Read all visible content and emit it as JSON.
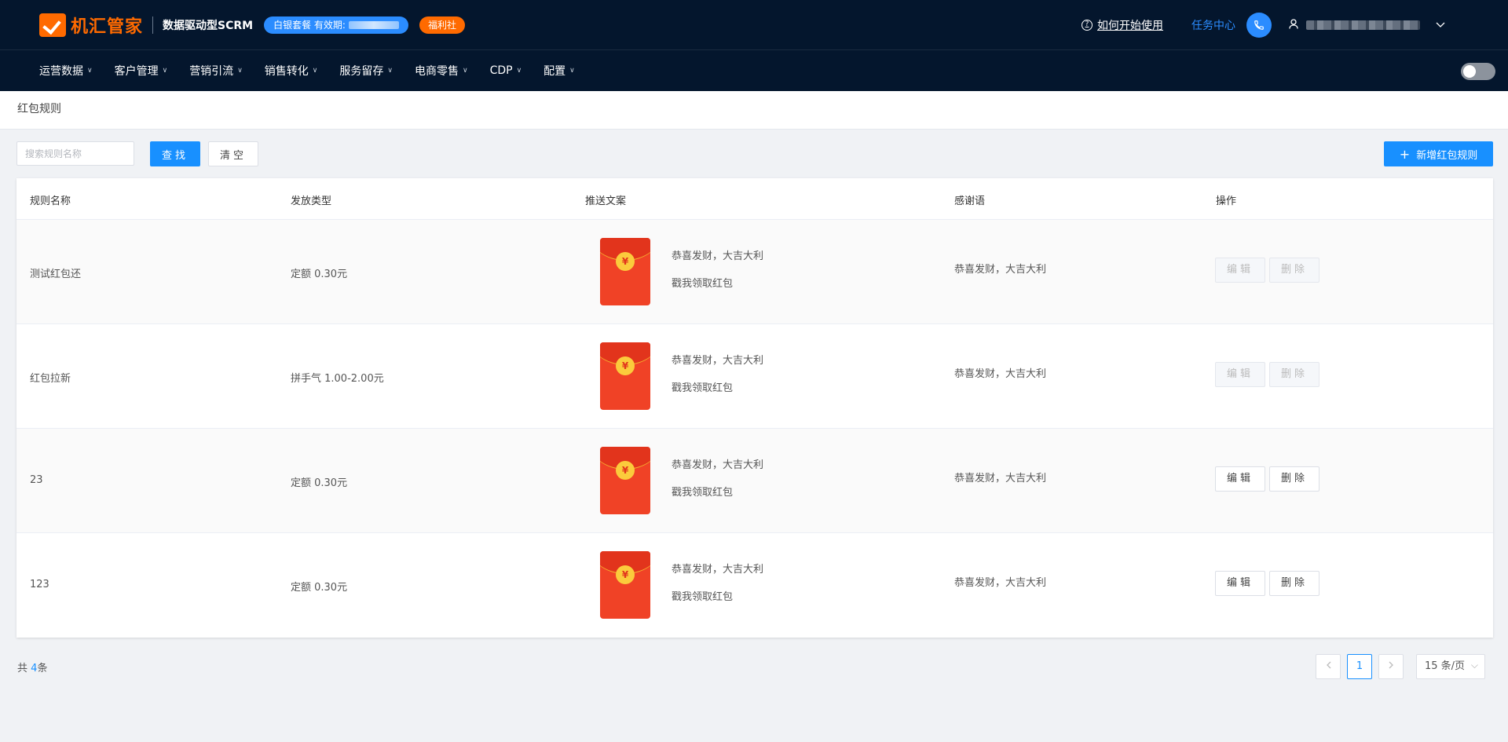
{
  "header": {
    "logo_text": "机汇管家",
    "logo_sub": "数据驱动型SCRM",
    "package_label": "白银套餐  有效期:",
    "welfare_label": "福利社",
    "help_label": "如何开始使用",
    "task_label": "任务中心"
  },
  "nav": {
    "items": [
      {
        "label": "运营数据"
      },
      {
        "label": "客户管理"
      },
      {
        "label": "营销引流"
      },
      {
        "label": "销售转化"
      },
      {
        "label": "服务留存"
      },
      {
        "label": "电商零售"
      },
      {
        "label": "CDP"
      },
      {
        "label": "配置"
      }
    ]
  },
  "breadcrumb": "红包规则",
  "toolbar": {
    "search_placeholder": "搜索规则名称",
    "search_label": "查找",
    "clear_label": "清空",
    "add_label": "新增红包规则"
  },
  "table": {
    "columns": [
      "规则名称",
      "发放类型",
      "推送文案",
      "感谢语",
      "操作"
    ],
    "rows": [
      {
        "name": "测试红包还",
        "type": "定额 0.30元",
        "push_title": "恭喜发财，大吉大利",
        "push_sub": "戳我领取红包",
        "thanks": "恭喜发财，大吉大利",
        "edit": "编辑",
        "delete": "删除",
        "disabled": true
      },
      {
        "name": "红包拉新",
        "type": "拼手气 1.00-2.00元",
        "push_title": "恭喜发财，大吉大利",
        "push_sub": "戳我领取红包",
        "thanks": "恭喜发财，大吉大利",
        "edit": "编辑",
        "delete": "删除",
        "disabled": true
      },
      {
        "name": "23",
        "type": "定额 0.30元",
        "push_title": "恭喜发财，大吉大利",
        "push_sub": "戳我领取红包",
        "thanks": "恭喜发财，大吉大利",
        "edit": "编辑",
        "delete": "删除",
        "disabled": false
      },
      {
        "name": "123",
        "type": "定额 0.30元",
        "push_title": "恭喜发财，大吉大利",
        "push_sub": "戳我领取红包",
        "thanks": "恭喜发财，大吉大利",
        "edit": "编辑",
        "delete": "删除",
        "disabled": false
      }
    ]
  },
  "footer": {
    "total_prefix": "共",
    "total_count": "4",
    "total_suffix": "条",
    "current_page": "1",
    "page_size": "15 条/页"
  },
  "colors": {
    "header_bg": "#04162d",
    "primary": "#1890ff",
    "brand_orange": "#ff6a00",
    "envelope_red": "#f04226"
  },
  "icons": {
    "coin": "¥"
  }
}
